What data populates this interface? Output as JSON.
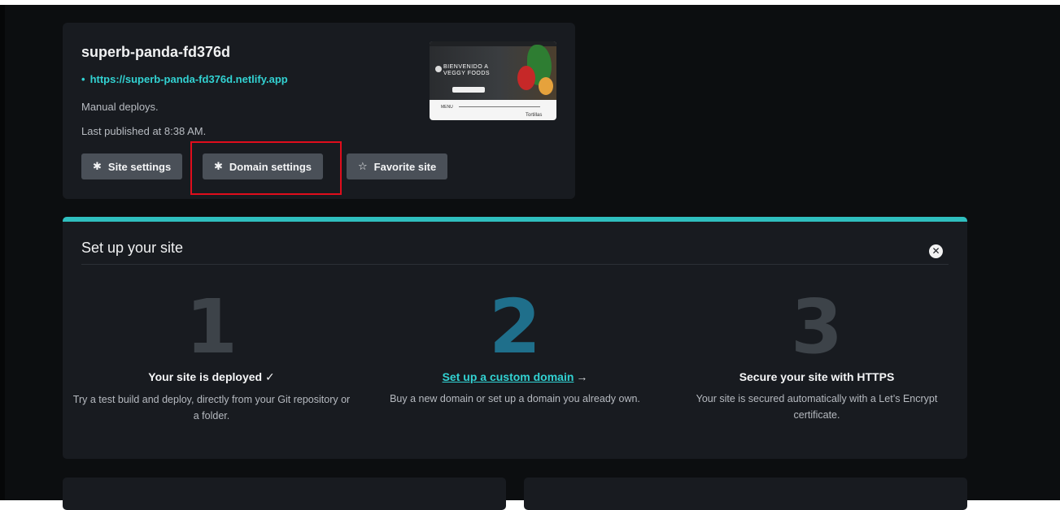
{
  "site": {
    "name": "superb-panda-fd376d",
    "url": "https://superb-panda-fd376d.netlify.app",
    "deploy_mode": "Manual deploys.",
    "last_published": "Last published at 8:38 AM.",
    "thumbnail": {
      "heading_line1": "BIENVENIDO A",
      "heading_line2": "VEGGY FOODS",
      "menu_label": "MENU",
      "item_label": "Tortillas"
    }
  },
  "buttons": {
    "site_settings": "Site settings",
    "domain_settings": "Domain settings",
    "favorite_site": "Favorite site"
  },
  "icons": {
    "site_settings": "gear-icon",
    "domain_settings": "gear-icon",
    "favorite_site": "star-outline-icon",
    "close": "close-circle-icon"
  },
  "setup": {
    "title": "Set up your site",
    "steps": [
      {
        "number": "1",
        "title": "Your site is deployed ✓",
        "description": "Try a test build and deploy, directly from your Git repository or a folder."
      },
      {
        "number": "2",
        "title": "Set up a custom domain",
        "title_arrow": "→",
        "description": "Buy a new domain or set up a domain you already own."
      },
      {
        "number": "3",
        "title": "Secure your site with HTTPS",
        "description": "Your site is secured automatically with a Let’s Encrypt certificate."
      }
    ]
  },
  "colors": {
    "background": "#0c0e10",
    "card": "#181b20",
    "accent_teal": "#32d2d2",
    "highlight": "#e00d1c",
    "button": "#4a5058"
  }
}
